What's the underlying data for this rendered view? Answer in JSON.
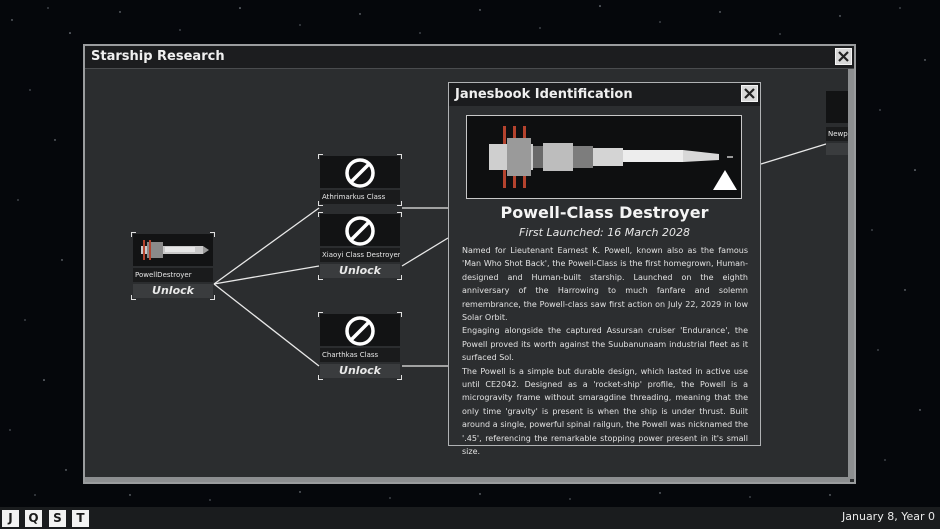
{
  "window": {
    "title": "Starship Research"
  },
  "nodes": {
    "powell": {
      "name": "PowellDestroyer",
      "button": "Unlock"
    },
    "athrimarkus": {
      "name": "Athrimarkus Class"
    },
    "xiaoyi": {
      "name": "Xiaoyi Class Destroyer",
      "button": "Unlock"
    },
    "charthkas": {
      "name": "Charthkas Class",
      "button": "Unlock"
    },
    "newport": {
      "name": "Newpo"
    }
  },
  "popup": {
    "title": "Janesbook Identification",
    "ship_name": "Powell-Class Destroyer",
    "launched": "First Launched: 16 March 2028",
    "paragraphs": [
      "Named for Lieutenant Earnest K. Powell, known also as the famous 'Man Who Shot Back', the Powell-Class is the first homegrown, Human-designed and Human-built starship. Launched on the eighth anniversary of the Harrowing to much fanfare and solemn remembrance, the Powell-class saw first action on July 22, 2029 in low Solar Orbit.",
      "Engaging alongside the captured Assursan cruiser 'Endurance', the Powell proved its worth against the Suubanunaam industrial fleet as it surfaced Sol.",
      "The Powell is a simple but durable design, which lasted in active use until CE2042. Designed as a 'rocket-ship' profile, the Powell is a microgravity frame without smaragdine threading, meaning that the only time 'gravity' is present is when the ship is under thrust. Built around a single, powerful spinal railgun, the Powell was nicknamed the '.45', referencing the remarkable stopping power present in it's small size."
    ]
  },
  "taskbar": {
    "buttons": [
      "J",
      "Q",
      "S",
      "T"
    ],
    "date": "January 8, Year 0"
  },
  "colors": {
    "panel": "#2b2d2f",
    "background": "#05070b",
    "accent_red": "#b4432e"
  }
}
